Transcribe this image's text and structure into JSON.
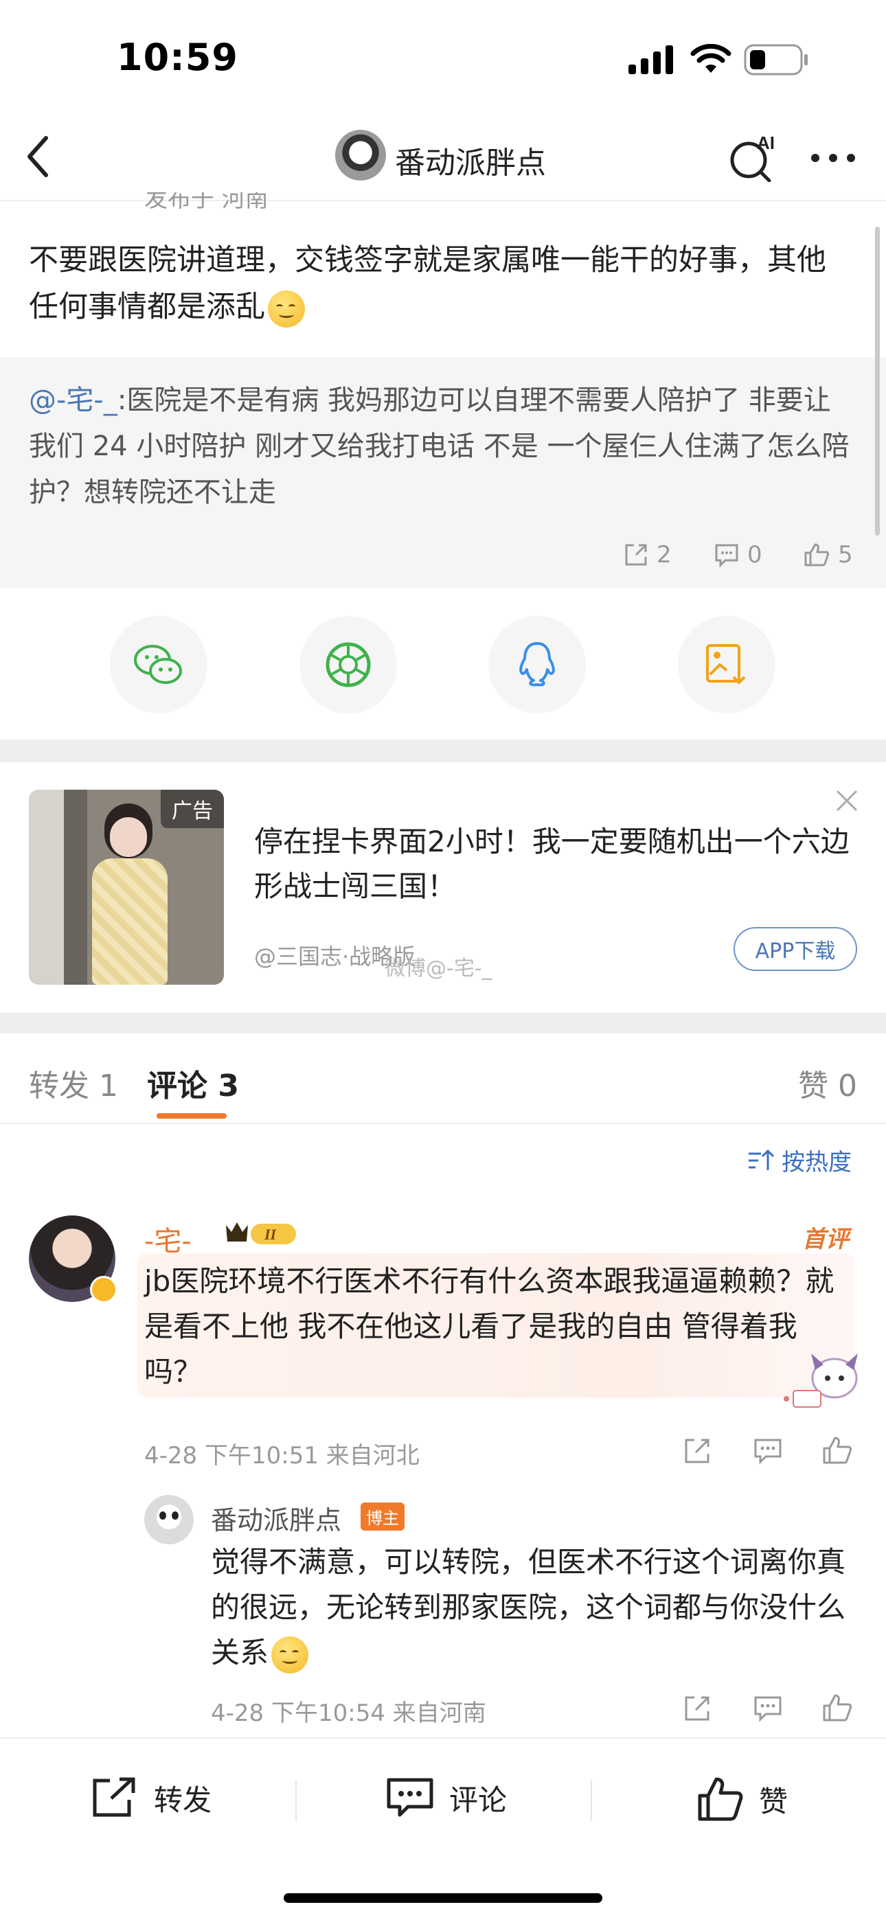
{
  "status": {
    "time": "10:59"
  },
  "nav": {
    "title": "番动派胖点",
    "ai_label": "AI"
  },
  "post": {
    "meta": "发布于 河南",
    "text": "不要跟医院讲道理，交钱签字就是家属唯一能干的好事，其他任何事情都是添乱"
  },
  "quote": {
    "user": "@-宅-_",
    "text": ":医院是不是有病 我妈那边可以自理不需要人陪护了 非要让我们 24 小时陪护 刚才又给我打电话 不是 一个屋仨人住满了怎么陪护？想转院还不让走",
    "reposts": "2",
    "comments": "0",
    "likes": "5"
  },
  "share": [
    "wechat-icon",
    "moments-icon",
    "qq-icon",
    "save-image-icon"
  ],
  "ad": {
    "badge": "广告",
    "title": "停在捏卡界面2小时！我一定要随机出一个六边形战士闯三国！",
    "source": "@三国志·战略版",
    "download": "APP下载",
    "watermark": "微博@-宅-_"
  },
  "tabs": {
    "repost": "转发 1",
    "comment": "评论 3",
    "like": "赞 0"
  },
  "sort_label": "按热度",
  "comment": {
    "name": "-宅-_",
    "level": "II",
    "first_badge": "首评",
    "text": "jb医院环境不行医术不行有什么资本跟我逼逼赖赖？就是看不上他 我不在他这儿看了是我的自由 管得着我吗？",
    "meta": "4-28 下午10:51 来自河北"
  },
  "reply": {
    "name": "番动派胖点",
    "badge": "博主",
    "text": "觉得不满意，可以转院，但医术不行这个词离你真的很远，无论转到那家医院，这个词都与你没什么关系",
    "meta": "4-28 下午10:54 来自河南"
  },
  "bottom": {
    "repost": "转发",
    "comment": "评论",
    "like": "赞"
  },
  "colors": {
    "accent_orange": "#f07a2b",
    "link_blue": "#4a77b6"
  }
}
